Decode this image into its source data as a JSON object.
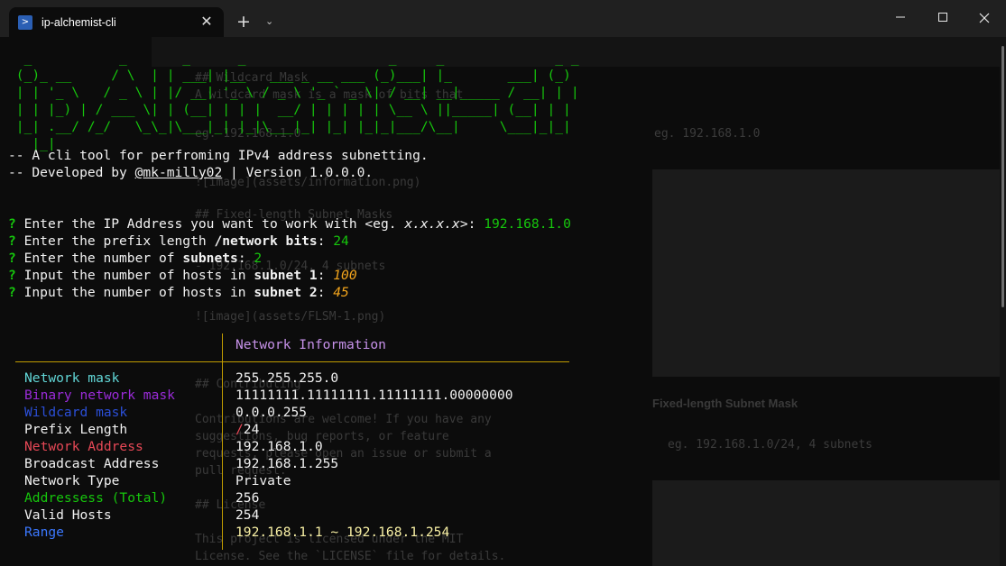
{
  "window": {
    "tab_title": "ip-alchemist-cli",
    "new_tab_glyph": "+",
    "tab_menu_glyph": "⌄",
    "close_tab_glyph": "✕",
    "minimize_glyph": "—",
    "maximize_glyph": "☐",
    "close_glyph": "✕"
  },
  "banner": [
    "  _           _       _      _                  _     _              _ _ ",
    " (_)_ __     / \\  | | ___| |__   ___ _ __ ___ (_)___| |_       ___| (_)",
    " | | '_ \\   / _ \\ | |/ __| '_ \\ / _ \\ '_ ` _ \\| / __| __|_____ / __| | |",
    " | | |_) | / ___ \\| | (__| | | |  __/ | | | | | \\__ \\ ||_____| (__| | |",
    " |_| .__/ /_/   \\_\\_|\\___|_| |_|\\___|_| |_| |_|_|___/\\__|     \\___|_|_|",
    "   |_|"
  ],
  "intro": {
    "line1": "-- A cli tool for perfroming IPv4 address subnetting.",
    "line2_prefix": "-- Developed by ",
    "line2_author": "@mk-milly02",
    "line2_suffix": " | Version 1.0.0.0."
  },
  "prompts": [
    {
      "mark": "?",
      "text_a": " Enter the IP Address you want to work with <eg. ",
      "text_em": "x.x.x.x",
      "text_b": ">: ",
      "answer": "192.168.1.0",
      "kind": "green"
    },
    {
      "mark": "?",
      "text_a": " Enter the prefix length ",
      "text_bold": "/network bits",
      "text_b": ": ",
      "answer": "24",
      "kind": "green"
    },
    {
      "mark": "?",
      "text_a": " Enter the number of ",
      "text_bold": "subnets",
      "text_b": ": ",
      "answer": "2",
      "kind": "green"
    },
    {
      "mark": "?",
      "text_a": " Input the number of hosts in ",
      "text_bold": "subnet 1",
      "text_b": ": ",
      "answer": "100",
      "kind": "orange"
    },
    {
      "mark": "?",
      "text_a": " Input the number of hosts in ",
      "text_bold": "subnet 2",
      "text_b": ": ",
      "answer": "45",
      "kind": "orange"
    }
  ],
  "table": {
    "header": "Network Information",
    "rows": [
      {
        "label": "Network mask",
        "value": "255.255.255.0",
        "color": "#61d6d6"
      },
      {
        "label": "Binary network mask",
        "value": "11111111.11111111.11111111.00000000",
        "color": "#9a2bd8"
      },
      {
        "label": "Wildcard mask",
        "value": "0.0.0.255",
        "color": "#2b4fd8"
      },
      {
        "label": "Prefix Length",
        "value_mark": "/",
        "value": "24",
        "color": "#f2f2f2"
      },
      {
        "label": "Network Address",
        "value": "192.168.1.0",
        "color": "#e74856"
      },
      {
        "label": "Broadcast Address",
        "value": "192.168.1.255",
        "color": "#f2f2f2"
      },
      {
        "label": "Network Type",
        "value": "Private",
        "color": "#f2f2f2"
      },
      {
        "label": "Addressess (Total)",
        "value": "256",
        "color": "#16c60c"
      },
      {
        "label": "Valid Hosts",
        "value": "254",
        "color": "#f2f2f2"
      },
      {
        "label": "Range",
        "value": "192.168.1.1 ~ 192.168.1.254",
        "color": "#3b78ff",
        "value_color": "#f9f1a5"
      }
    ]
  },
  "ghost": {
    "lines": [
      "## Wildcard Mask",
      "A wildcard mask is a mask of bits that",
      "eg. 192.168.1.0",
      "![image](assets/information.png)",
      "## Fixed-length Subnet Masks",
      "- 192.168.1.0/24, 4 subnets",
      "![image](assets/FLSM-1.png)",
      "## Contributing",
      "Contributions are welcome! If you have any",
      "suggestions, bug reports, or feature",
      "requests, please open an issue or submit a",
      "pull request.",
      "## License",
      "This project is licensed under the MIT",
      "License. See the `LICENSE` file for details."
    ],
    "right_text_1": "eg. 192.168.1.0",
    "right_caption": "Fixed-length Subnet Mask",
    "right_text_2": "eg. 192.168.1.0/24, 4 subnets"
  }
}
